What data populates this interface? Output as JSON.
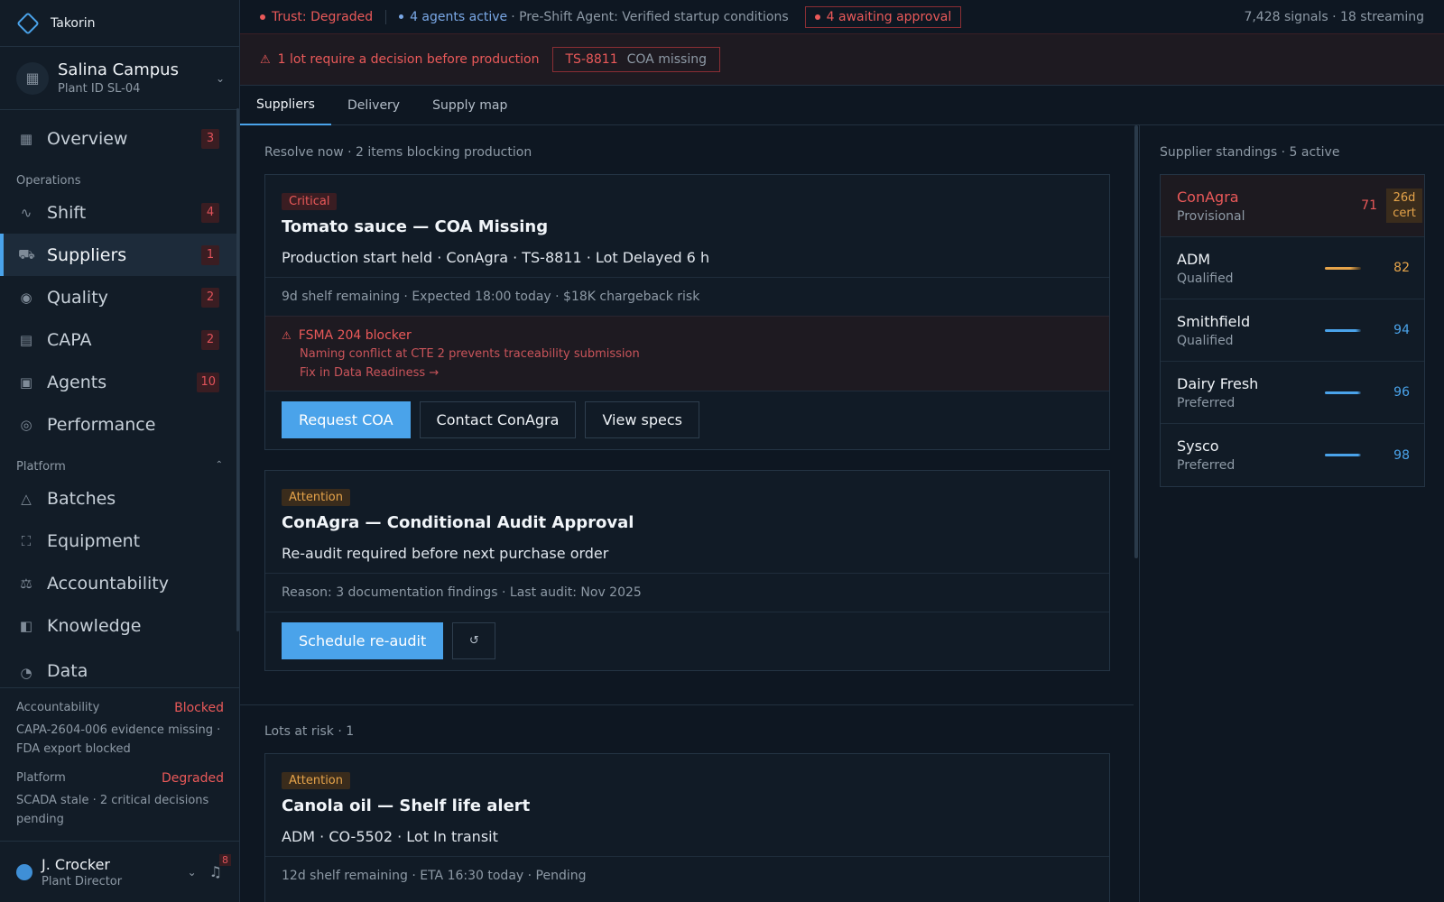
{
  "app": {
    "name": "Takorin"
  },
  "site": {
    "name": "Salina Campus",
    "plant_id": "Plant ID SL-04"
  },
  "nav": {
    "overview": {
      "label": "Overview",
      "badge": "3"
    },
    "operations_label": "Operations",
    "operations": [
      {
        "label": "Shift",
        "badge": "4",
        "icon": "pulse-icon"
      },
      {
        "label": "Suppliers",
        "badge": "1",
        "icon": "truck-icon"
      },
      {
        "label": "Quality",
        "badge": "2",
        "icon": "eye-icon"
      },
      {
        "label": "CAPA",
        "badge": "2",
        "icon": "clipboard-icon"
      },
      {
        "label": "Agents",
        "badge": "10",
        "icon": "cpu-icon"
      },
      {
        "label": "Performance",
        "badge": "",
        "icon": "target-icon"
      }
    ],
    "platform_label": "Platform",
    "platform": [
      {
        "label": "Batches",
        "icon": "flask-icon"
      },
      {
        "label": "Equipment",
        "icon": "scan-icon"
      },
      {
        "label": "Accountability",
        "icon": "scale-icon"
      },
      {
        "label": "Knowledge",
        "icon": "book-icon"
      },
      {
        "label": "Data",
        "icon": "gauge-icon"
      }
    ]
  },
  "status": {
    "accountability": {
      "label": "Accountability",
      "state": "Blocked",
      "desc": "CAPA-2604-006 evidence missing · FDA export blocked"
    },
    "platform": {
      "label": "Platform",
      "state": "Degraded",
      "desc": "SCADA stale · 2 critical decisions pending"
    }
  },
  "user": {
    "name": "J. Crocker",
    "role": "Plant Director",
    "notifications": "8"
  },
  "topbar": {
    "trust": "Trust: Degraded",
    "agents": "4 agents active",
    "preshift": "· Pre-Shift Agent: Verified startup conditions",
    "awaiting": "4 awaiting approval",
    "signals": "7,428 signals · 18 streaming"
  },
  "alert": {
    "text": "1 lot require a decision before production",
    "code": "TS-8811",
    "msg": "COA missing"
  },
  "tabs": [
    "Suppliers",
    "Delivery",
    "Supply map"
  ],
  "resolve": {
    "title": "Resolve now · 2 items blocking production",
    "card1": {
      "tag": "Critical",
      "title": "Tomato sauce — COA Missing",
      "line": "Production start held · ConAgra · TS-8811 · Lot Delayed 6 h",
      "meta": "9d shelf remaining · Expected 18:00 today · $18K chargeback risk",
      "blocker_title": "FSMA 204 blocker",
      "blocker_line": "Naming conflict at CTE 2 prevents traceability submission",
      "blocker_link": "Fix in Data Readiness →",
      "actions": [
        "Request COA",
        "Contact ConAgra",
        "View specs"
      ]
    },
    "card2": {
      "tag": "Attention",
      "title": "ConAgra — Conditional Audit Approval",
      "line": "Re-audit required before next purchase order",
      "meta": "Reason: 3 documentation findings · Last audit: Nov 2025",
      "action": "Schedule re-audit"
    }
  },
  "lots": {
    "title": "Lots at risk · 1",
    "card": {
      "tag": "Attention",
      "title": "Canola oil — Shelf life alert",
      "line": "ADM · CO-5502 · Lot In transit",
      "meta": "12d shelf remaining · ETA 16:30 today · Pending"
    }
  },
  "standings": {
    "title": "Supplier standings · 5 active",
    "items": [
      {
        "name": "ConAgra",
        "tier": "Provisional",
        "score": "71",
        "cert_days": "26d",
        "cert_label": "cert",
        "color": "#ea5959"
      },
      {
        "name": "ADM",
        "tier": "Qualified",
        "score": "82",
        "color": "#e6a44a"
      },
      {
        "name": "Smithfield",
        "tier": "Qualified",
        "score": "94",
        "color": "#4aa3ea"
      },
      {
        "name": "Dairy Fresh",
        "tier": "Preferred",
        "score": "96",
        "color": "#4aa3ea"
      },
      {
        "name": "Sysco",
        "tier": "Preferred",
        "score": "98",
        "color": "#4aa3ea"
      }
    ]
  }
}
